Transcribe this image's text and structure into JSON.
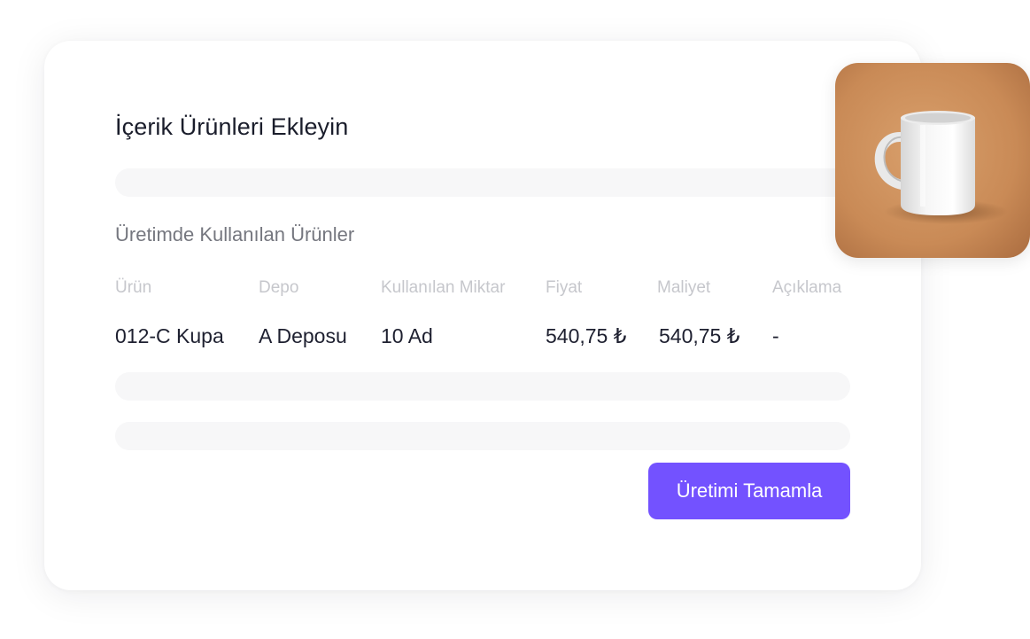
{
  "card": {
    "title": "İçerik Ürünleri Ekleyin",
    "section_title": "Üretimde Kullanılan Ürünler"
  },
  "table": {
    "columns": [
      "Ürün",
      "Depo",
      "Kullanılan Miktar",
      "Fiyat",
      "Maliyet",
      "Açıklama"
    ],
    "rows": [
      [
        "012-C Kupa",
        "A Deposu",
        "10 Ad",
        "540,75 ₺",
        "540,75 ₺",
        "-"
      ]
    ]
  },
  "actions": {
    "complete_label": "Üretimi Tamamla"
  },
  "product_image": {
    "subject": "white-mug-icon"
  },
  "colors": {
    "accent": "#7352ff",
    "photo_background": "#c98a56"
  }
}
